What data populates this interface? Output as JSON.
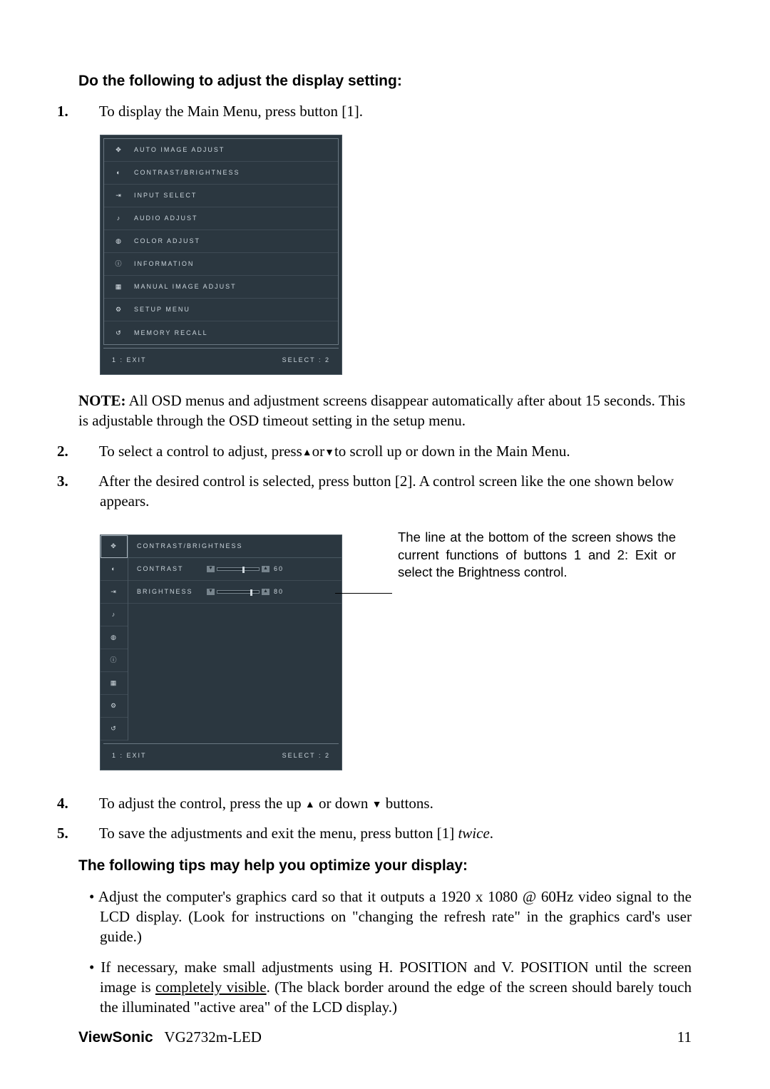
{
  "heading1": "Do the following to adjust the display setting:",
  "step1": {
    "num": "1.",
    "text": "To display the Main Menu, press button [1]."
  },
  "osd1": {
    "items": [
      {
        "icon": "auto-adjust-icon",
        "label": "AUTO IMAGE ADJUST"
      },
      {
        "icon": "contrast-icon",
        "label": "CONTRAST/BRIGHTNESS"
      },
      {
        "icon": "input-select-icon",
        "label": "INPUT SELECT"
      },
      {
        "icon": "audio-icon",
        "label": "AUDIO ADJUST"
      },
      {
        "icon": "color-icon",
        "label": "COLOR ADJUST"
      },
      {
        "icon": "info-icon",
        "label": "INFORMATION"
      },
      {
        "icon": "manual-adjust-icon",
        "label": "MANUAL IMAGE ADJUST"
      },
      {
        "icon": "setup-icon",
        "label": "SETUP MENU"
      },
      {
        "icon": "recall-icon",
        "label": "MEMORY RECALL"
      }
    ],
    "foot_left": "1 : EXIT",
    "foot_right": "SELECT : 2"
  },
  "note": {
    "label": "NOTE:",
    "text": "All OSD menus and adjustment screens disappear automatically after about 15 seconds. This is adjustable through the OSD timeout setting in the setup menu."
  },
  "step2": {
    "num": "2.",
    "prefix": "To select a control to adjust, press",
    "mid": "or",
    "suffix": "to scroll up or down in the Main Menu."
  },
  "step3": {
    "num": "3.",
    "text": "After the desired control is selected, press button [2]. A control screen like the one shown below appears."
  },
  "osd2": {
    "title": "CONTRAST/BRIGHTNESS",
    "rows": [
      {
        "label": "CONTRAST",
        "value": "60",
        "pct": 60
      },
      {
        "label": "BRIGHTNESS",
        "value": "80",
        "pct": 80
      }
    ],
    "foot_left": "1 : EXIT",
    "foot_right": "SELECT : 2"
  },
  "callout": "The line at the bottom of the screen shows the current functions of buttons 1 and 2: Exit or select the Brightness control.",
  "step4": {
    "num": "4.",
    "prefix": "To adjust the control, press the up ",
    "mid": " or down ",
    "suffix": " buttons."
  },
  "step5": {
    "num": "5.",
    "prefix": "To save the adjustments and exit the menu, press button [1] ",
    "em": "twice",
    "suffix": "."
  },
  "heading2": "The following tips may help you optimize your display:",
  "tip1": "Adjust the computer's graphics card so that it outputs a 1920 x 1080 @ 60Hz video signal to the LCD display. (Look for instructions on \"changing the refresh rate\" in the graphics card's user guide.)",
  "tip2": {
    "a": "If necessary, make small adjustments using H. POSITION and V. POSITION until the screen image is ",
    "u": "completely visible",
    "b": ". (The black border around the edge of the screen should barely touch the illuminated \"active area\" of the LCD display.)"
  },
  "footer": {
    "brand": "ViewSonic",
    "model": "VG2732m-LED",
    "page": "11"
  },
  "glyphs": {
    "up": "▲",
    "down": "▼"
  }
}
